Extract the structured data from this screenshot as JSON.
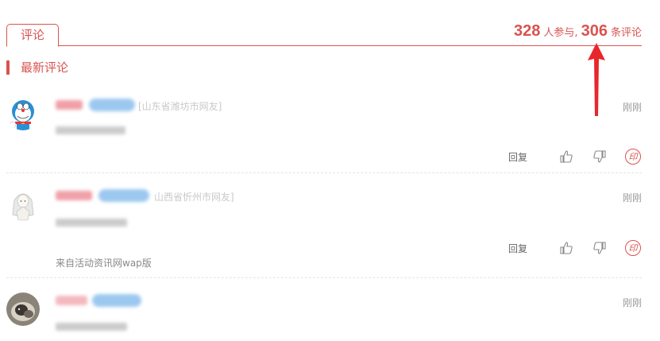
{
  "tabs": {
    "active_label": "评论"
  },
  "stats": {
    "participants": "328",
    "participants_suffix": "人参与,",
    "comments": "306",
    "comments_suffix": "条评论"
  },
  "section": {
    "title": "最新评论"
  },
  "comments": [
    {
      "location": "[山东省潍坊市网友]",
      "time": "刚刚",
      "reply": "回复",
      "print_label": "印",
      "avatar_icon": "doraemon-avatar"
    },
    {
      "location": "山西省忻州市网友]",
      "time": "刚刚",
      "reply": "回复",
      "print_label": "印",
      "source": "来自活动资讯网wap版",
      "avatar_icon": "anime-girl-avatar"
    },
    {
      "time": "刚刚",
      "avatar_icon": "cat-photo-avatar"
    }
  ],
  "colors": {
    "accent": "#d9534f",
    "divider": "#e5e5e5"
  }
}
